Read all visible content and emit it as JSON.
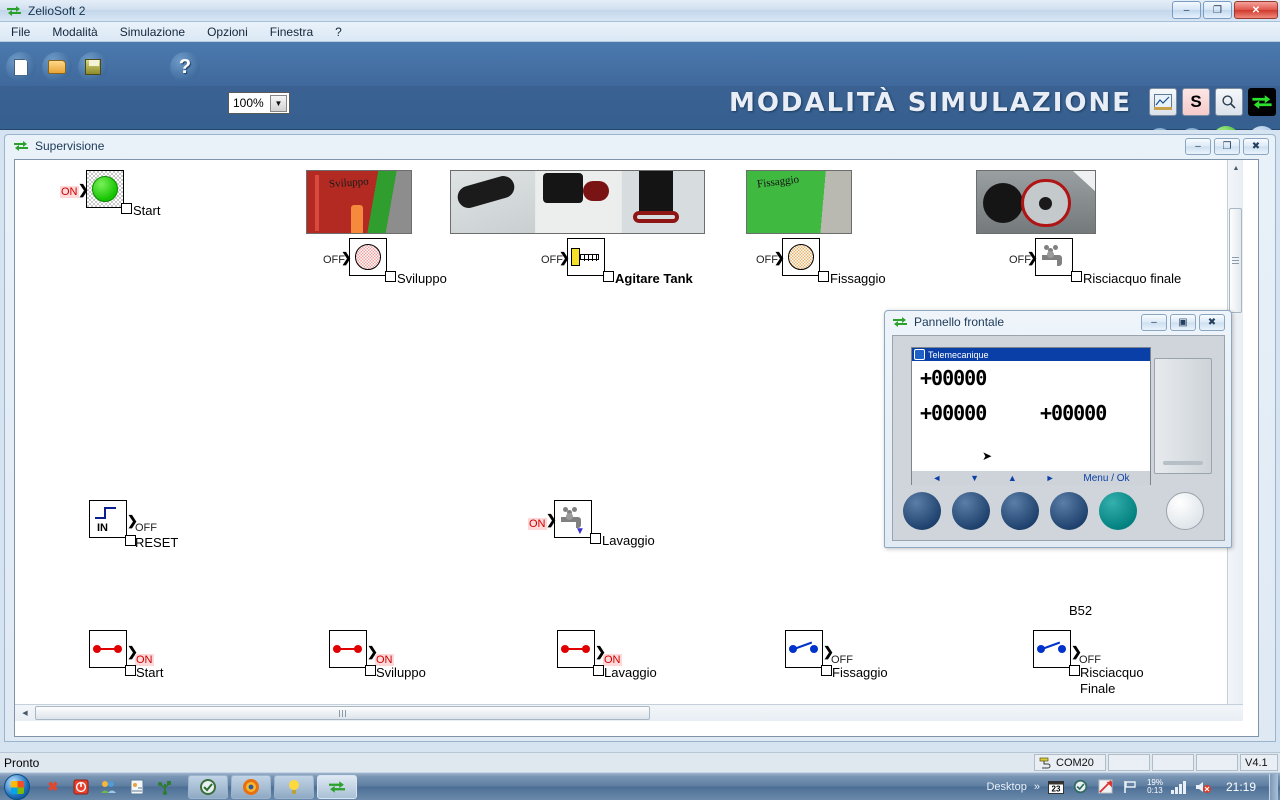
{
  "window": {
    "title": "ZelioSoft 2",
    "icon": "zeliosoft-icon",
    "controls": {
      "minimize": "–",
      "maximize": "❐",
      "close": "✕"
    }
  },
  "menu": {
    "items": [
      "File",
      "Modalità",
      "Simulazione",
      "Opzioni",
      "Finestra",
      "?"
    ]
  },
  "toolbar": {
    "new_label": "new-document",
    "open_label": "open-folder",
    "save_label": "save-diskette",
    "help_label": "?",
    "zoom_value": "100%",
    "zoom_arrow": "▼",
    "mode_title": "MODALITÀ SIMULAZIONE",
    "s_button": "S",
    "buttons": {
      "pause": "pause",
      "bolt": "bolt",
      "run": "Run",
      "stop": "Stop"
    }
  },
  "supervision": {
    "title": "Supervisione",
    "controls": {
      "minimize": "–",
      "restore": "❐",
      "close": "✖"
    },
    "outputs": [
      {
        "state": "ON",
        "label": "Start",
        "icon": "green-lamp-icon",
        "bold": false
      },
      {
        "state": "OFF",
        "label": "Sviluppo",
        "icon": "red-lamp-icon",
        "bold": false
      },
      {
        "state": "OFF",
        "label": "Agitare Tank",
        "icon": "cylinder-icon",
        "bold": true
      },
      {
        "state": "OFF",
        "label": "Fissaggio",
        "icon": "tan-lamp-icon",
        "bold": false
      },
      {
        "state": "OFF",
        "label": "Risciacquo finale",
        "icon": "faucet-icon",
        "bold": false
      },
      {
        "state": "OFF",
        "label": "RESET",
        "icon": "pushbutton-in-icon",
        "bold": false
      },
      {
        "state": "ON",
        "label": "Lavaggio",
        "icon": "faucet-flow-icon",
        "bold": false
      }
    ],
    "contacts": [
      {
        "state": "ON",
        "label": "Start",
        "label2": "",
        "tag": "",
        "closed": true
      },
      {
        "state": "ON",
        "label": "Sviluppo",
        "label2": "",
        "tag": "",
        "closed": true
      },
      {
        "state": "ON",
        "label": "Lavaggio",
        "label2": "",
        "tag": "",
        "closed": true
      },
      {
        "state": "OFF",
        "label": "Fissaggio",
        "label2": "",
        "tag": "",
        "closed": false
      },
      {
        "state": "OFF",
        "label": "Risciacquo",
        "label2": "Finale",
        "tag": "B52",
        "closed": false
      }
    ],
    "in_icon_text": "IN"
  },
  "panel": {
    "title": "Pannello frontale",
    "controls": {
      "minimize": "–",
      "restore": "▣",
      "close": "✖"
    },
    "lcd": {
      "brand": "Telemecanique",
      "value_top": "+00000",
      "value_left": "+00000",
      "value_right": "+00000",
      "nav": [
        "◄",
        "▼",
        "▲",
        "►"
      ],
      "menu_ok": "Menu / Ok"
    },
    "buttons": [
      "btn-left",
      "btn-down",
      "btn-up",
      "btn-right",
      "btn-menu-ok",
      "btn-white"
    ]
  },
  "statusbar": {
    "message": "Pronto",
    "com_port": "COM20",
    "com_icon": "serial-plug-icon",
    "cell2": "",
    "cell3": "",
    "cell4": "",
    "version": "V4.1"
  },
  "taskbar": {
    "start": "start-orb",
    "quick_icons": [
      "red-x-icon",
      "power-icon",
      "users-icon",
      "contacts-icon",
      "usb-icon"
    ],
    "apps": [
      "shield-icon",
      "firefox-icon",
      "bulb-icon",
      "zeliosoft-icon"
    ],
    "tray": {
      "desktop_label": "Desktop",
      "overflow": "»",
      "calendar": "23",
      "battery_percent": "19%",
      "battery_time": "0:13",
      "clock": "21:19"
    }
  },
  "colors": {
    "toolbar_blue": "#40699d",
    "title_text": "#e9eef6",
    "on_red": "#cc0000",
    "lamp_green": "#14c400",
    "lcd_blue": "#0b3fa8"
  }
}
